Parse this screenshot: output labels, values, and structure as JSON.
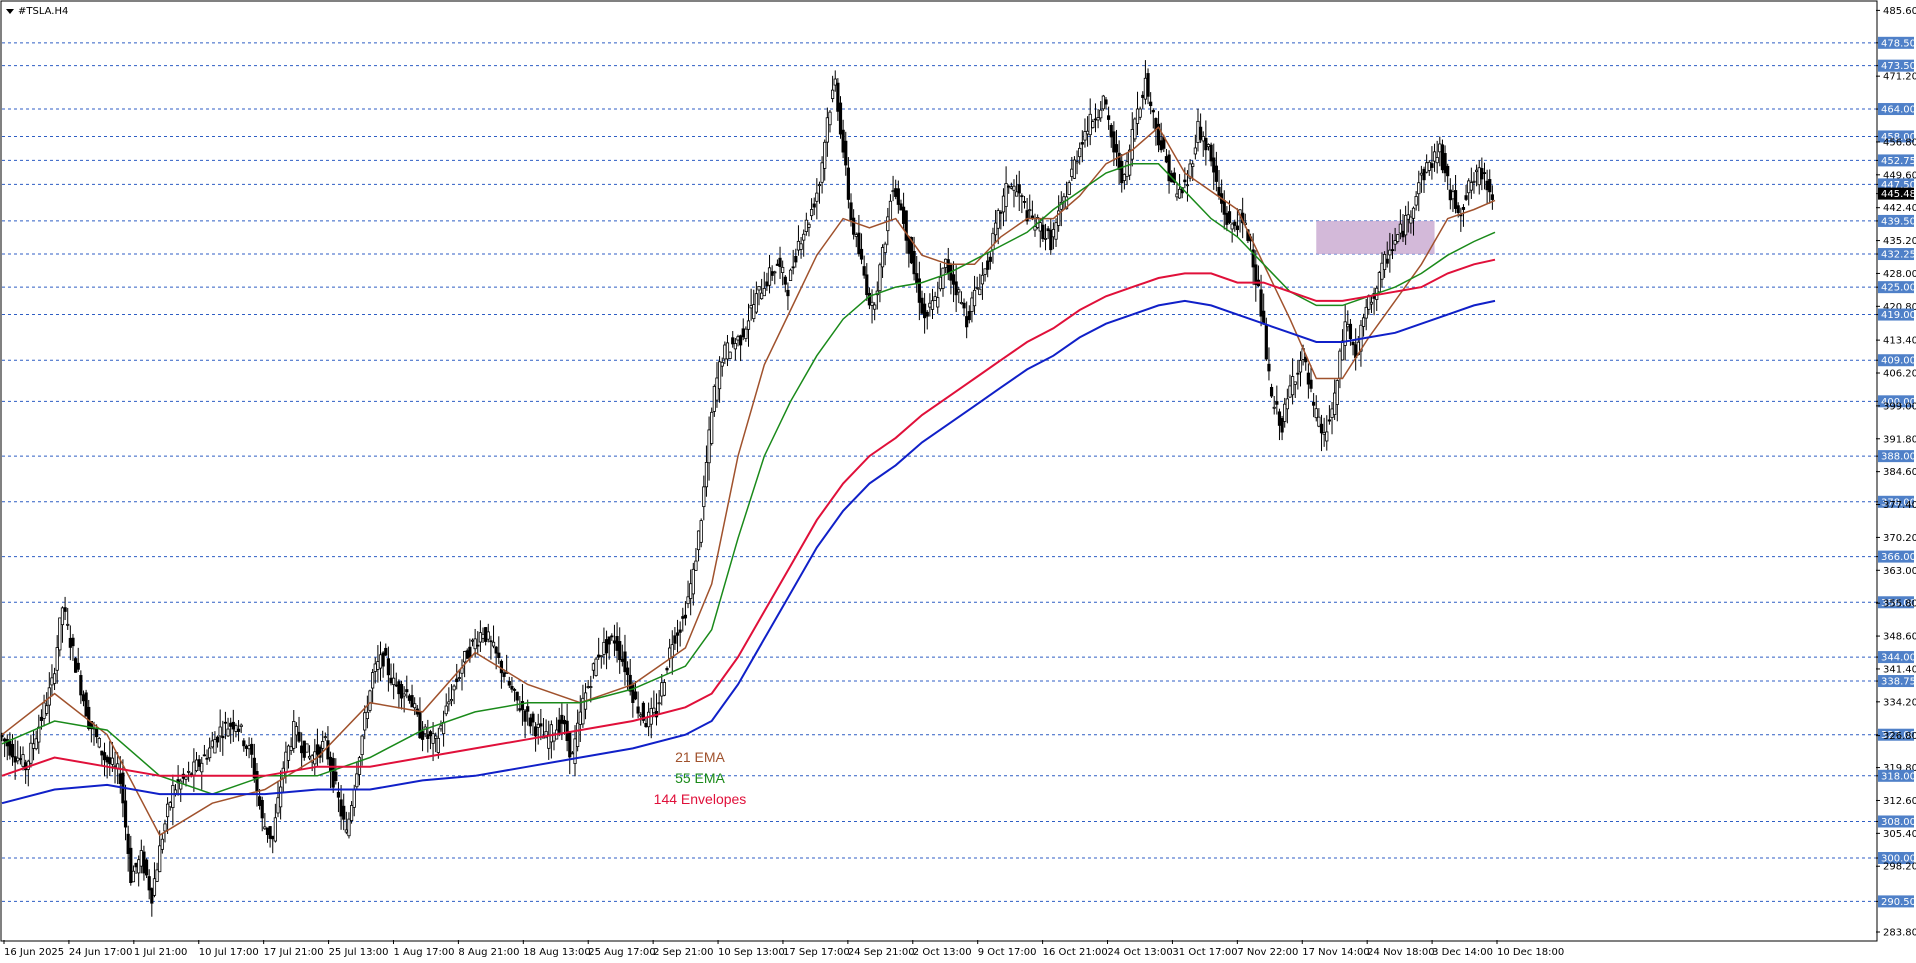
{
  "symbol": "#TSLA.H4",
  "colors": {
    "level_line": "#2f5ec4",
    "level_label_bg": "#4f80c8",
    "ema21": "#a0522d",
    "ema55": "#1a8a1a",
    "env144_upper": "#e0103a",
    "env144_lower": "#1020c8",
    "candle": "#000000",
    "zone": "#c8a8d0",
    "price_label_bg": "#000000"
  },
  "legend": [
    {
      "text": "21 EMA",
      "color": "#a0522d"
    },
    {
      "text": "55 EMA",
      "color": "#1a8a1a"
    },
    {
      "text": "144 Envelopes",
      "color": "#e0103a"
    }
  ],
  "y_ticks": [
    "485.60",
    "478.50",
    "473.50",
    "471.20",
    "464.00",
    "458.00",
    "456.80",
    "452.75",
    "449.60",
    "447.50",
    "445.48",
    "442.40",
    "439.50",
    "435.20",
    "432.25",
    "428.00",
    "425.00",
    "420.80",
    "419.00",
    "413.40",
    "409.00",
    "406.20",
    "400.00",
    "399.00",
    "391.80",
    "388.00",
    "384.60",
    "378.00",
    "377.40",
    "370.20",
    "366.00",
    "363.00",
    "356.00",
    "355.80",
    "348.60",
    "344.00",
    "341.40",
    "338.75",
    "334.20",
    "327.00",
    "326.80",
    "319.80",
    "318.00",
    "312.60",
    "308.00",
    "305.40",
    "300.00",
    "298.20",
    "290.50",
    "283.80"
  ],
  "x_ticks": [
    "16 Jun 2025",
    "24 Jun 17:00",
    "1 Jul 21:00",
    "10 Jul 17:00",
    "17 Jul 21:00",
    "25 Jul 13:00",
    "1 Aug 17:00",
    "8 Aug 21:00",
    "18 Aug 13:00",
    "25 Aug 17:00",
    "2 Sep 21:00",
    "10 Sep 13:00",
    "17 Sep 17:00",
    "24 Sep 21:00",
    "2 Oct 13:00",
    "9 Oct 17:00",
    "16 Oct 21:00",
    "24 Oct 13:00",
    "31 Oct 17:00",
    "7 Nov 22:00",
    "17 Nov 14:00",
    "24 Nov 18:00",
    "3 Dec 14:00",
    "10 Dec 18:00"
  ],
  "chart_data": {
    "type": "candlestick",
    "title": "#TSLA.H4",
    "ylim": [
      283.8,
      487.0
    ],
    "current_price": 445.48,
    "levels": [
      478.5,
      473.5,
      464.0,
      458.0,
      452.75,
      447.5,
      439.5,
      432.25,
      425.0,
      419.0,
      409.0,
      400.0,
      388.0,
      378.0,
      366.0,
      356.0,
      344.0,
      338.75,
      327.0,
      318.0,
      308.0,
      300.0,
      290.5
    ],
    "zone": {
      "from_x": "24 Nov 18:00",
      "to_x": "10 Dec 18:00",
      "low": 432.25,
      "high": 439.5
    },
    "price_path": [
      [
        0,
        327
      ],
      [
        10,
        320
      ],
      [
        20,
        338
      ],
      [
        24,
        355
      ],
      [
        28,
        345
      ],
      [
        34,
        330
      ],
      [
        40,
        322
      ],
      [
        46,
        318
      ],
      [
        50,
        296
      ],
      [
        54,
        300
      ],
      [
        58,
        292
      ],
      [
        62,
        305
      ],
      [
        66,
        315
      ],
      [
        72,
        318
      ],
      [
        78,
        322
      ],
      [
        84,
        328
      ],
      [
        90,
        330
      ],
      [
        96,
        322
      ],
      [
        100,
        308
      ],
      [
        104,
        304
      ],
      [
        108,
        320
      ],
      [
        112,
        328
      ],
      [
        118,
        322
      ],
      [
        124,
        325
      ],
      [
        128,
        315
      ],
      [
        132,
        305
      ],
      [
        136,
        320
      ],
      [
        142,
        340
      ],
      [
        146,
        344
      ],
      [
        150,
        338
      ],
      [
        156,
        336
      ],
      [
        160,
        328
      ],
      [
        166,
        325
      ],
      [
        172,
        336
      ],
      [
        178,
        345
      ],
      [
        184,
        350
      ],
      [
        190,
        343
      ],
      [
        196,
        335
      ],
      [
        202,
        330
      ],
      [
        208,
        326
      ],
      [
        214,
        330
      ],
      [
        218,
        322
      ],
      [
        222,
        334
      ],
      [
        228,
        345
      ],
      [
        234,
        348
      ],
      [
        238,
        342
      ],
      [
        242,
        334
      ],
      [
        246,
        330
      ],
      [
        250,
        332
      ],
      [
        256,
        348
      ],
      [
        260,
        352
      ],
      [
        264,
        362
      ],
      [
        267,
        375
      ],
      [
        270,
        392
      ],
      [
        272,
        402
      ],
      [
        275,
        410
      ],
      [
        278,
        412
      ],
      [
        282,
        414
      ],
      [
        286,
        420
      ],
      [
        290,
        425
      ],
      [
        296,
        430
      ],
      [
        300,
        425
      ],
      [
        304,
        435
      ],
      [
        308,
        440
      ],
      [
        312,
        448
      ],
      [
        315,
        462
      ],
      [
        318,
        470
      ],
      [
        321,
        455
      ],
      [
        324,
        440
      ],
      [
        328,
        430
      ],
      [
        332,
        420
      ],
      [
        336,
        432
      ],
      [
        340,
        448
      ],
      [
        344,
        440
      ],
      [
        348,
        428
      ],
      [
        352,
        418
      ],
      [
        356,
        422
      ],
      [
        360,
        430
      ],
      [
        364,
        425
      ],
      [
        368,
        418
      ],
      [
        372,
        425
      ],
      [
        376,
        430
      ],
      [
        380,
        440
      ],
      [
        384,
        448
      ],
      [
        388,
        445
      ],
      [
        392,
        440
      ],
      [
        396,
        438
      ],
      [
        400,
        435
      ],
      [
        404,
        442
      ],
      [
        408,
        450
      ],
      [
        412,
        458
      ],
      [
        416,
        462
      ],
      [
        420,
        466
      ],
      [
        424,
        455
      ],
      [
        428,
        448
      ],
      [
        432,
        462
      ],
      [
        436,
        470
      ],
      [
        440,
        460
      ],
      [
        444,
        452
      ],
      [
        448,
        445
      ],
      [
        452,
        448
      ],
      [
        456,
        460
      ],
      [
        460,
        455
      ],
      [
        464,
        445
      ],
      [
        468,
        438
      ],
      [
        472,
        440
      ],
      [
        476,
        435
      ],
      [
        480,
        420
      ],
      [
        484,
        400
      ],
      [
        488,
        395
      ],
      [
        492,
        405
      ],
      [
        496,
        410
      ],
      [
        500,
        398
      ],
      [
        504,
        392
      ],
      [
        508,
        400
      ],
      [
        512,
        418
      ],
      [
        516,
        410
      ],
      [
        520,
        420
      ],
      [
        524,
        425
      ],
      [
        528,
        432
      ],
      [
        532,
        436
      ],
      [
        536,
        440
      ],
      [
        540,
        448
      ],
      [
        544,
        452
      ],
      [
        548,
        455
      ],
      [
        552,
        445
      ],
      [
        556,
        442
      ],
      [
        560,
        448
      ],
      [
        564,
        450
      ],
      [
        568,
        446
      ]
    ],
    "series": [
      {
        "name": "21 EMA",
        "points": [
          [
            0,
            327
          ],
          [
            20,
            336
          ],
          [
            40,
            327
          ],
          [
            60,
            305
          ],
          [
            80,
            312
          ],
          [
            100,
            315
          ],
          [
            120,
            322
          ],
          [
            140,
            334
          ],
          [
            160,
            332
          ],
          [
            180,
            345
          ],
          [
            200,
            338
          ],
          [
            220,
            334
          ],
          [
            240,
            338
          ],
          [
            260,
            346
          ],
          [
            270,
            360
          ],
          [
            280,
            388
          ],
          [
            290,
            408
          ],
          [
            300,
            420
          ],
          [
            310,
            432
          ],
          [
            320,
            440
          ],
          [
            330,
            438
          ],
          [
            340,
            440
          ],
          [
            350,
            432
          ],
          [
            360,
            430
          ],
          [
            370,
            430
          ],
          [
            380,
            436
          ],
          [
            390,
            440
          ],
          [
            400,
            440
          ],
          [
            410,
            445
          ],
          [
            420,
            452
          ],
          [
            430,
            455
          ],
          [
            440,
            460
          ],
          [
            450,
            450
          ],
          [
            460,
            446
          ],
          [
            470,
            442
          ],
          [
            480,
            430
          ],
          [
            490,
            418
          ],
          [
            500,
            405
          ],
          [
            510,
            405
          ],
          [
            520,
            414
          ],
          [
            530,
            422
          ],
          [
            540,
            430
          ],
          [
            550,
            440
          ],
          [
            560,
            442
          ],
          [
            568,
            444
          ]
        ]
      },
      {
        "name": "55 EMA",
        "points": [
          [
            0,
            325
          ],
          [
            20,
            330
          ],
          [
            40,
            328
          ],
          [
            60,
            318
          ],
          [
            80,
            314
          ],
          [
            100,
            318
          ],
          [
            120,
            318
          ],
          [
            140,
            322
          ],
          [
            160,
            328
          ],
          [
            180,
            332
          ],
          [
            200,
            334
          ],
          [
            220,
            334
          ],
          [
            240,
            337
          ],
          [
            260,
            342
          ],
          [
            270,
            350
          ],
          [
            280,
            370
          ],
          [
            290,
            388
          ],
          [
            300,
            400
          ],
          [
            310,
            410
          ],
          [
            320,
            418
          ],
          [
            330,
            423
          ],
          [
            340,
            425
          ],
          [
            350,
            426
          ],
          [
            360,
            428
          ],
          [
            370,
            431
          ],
          [
            380,
            434
          ],
          [
            390,
            437
          ],
          [
            400,
            442
          ],
          [
            410,
            446
          ],
          [
            420,
            450
          ],
          [
            430,
            452
          ],
          [
            440,
            452
          ],
          [
            450,
            446
          ],
          [
            460,
            440
          ],
          [
            470,
            436
          ],
          [
            480,
            430
          ],
          [
            490,
            424
          ],
          [
            500,
            421
          ],
          [
            510,
            421
          ],
          [
            520,
            423
          ],
          [
            530,
            425
          ],
          [
            540,
            428
          ],
          [
            550,
            432
          ],
          [
            560,
            435
          ],
          [
            568,
            437
          ]
        ]
      },
      {
        "name": "144 Envelopes",
        "points": [
          [
            0,
            318
          ],
          [
            20,
            322
          ],
          [
            40,
            320
          ],
          [
            60,
            318
          ],
          [
            80,
            318
          ],
          [
            100,
            318
          ],
          [
            120,
            320
          ],
          [
            140,
            320
          ],
          [
            160,
            322
          ],
          [
            180,
            324
          ],
          [
            200,
            326
          ],
          [
            220,
            328
          ],
          [
            240,
            330
          ],
          [
            260,
            333
          ],
          [
            270,
            336
          ],
          [
            280,
            344
          ],
          [
            290,
            354
          ],
          [
            300,
            364
          ],
          [
            310,
            374
          ],
          [
            320,
            382
          ],
          [
            330,
            388
          ],
          [
            340,
            392
          ],
          [
            350,
            397
          ],
          [
            360,
            401
          ],
          [
            370,
            405
          ],
          [
            380,
            409
          ],
          [
            390,
            413
          ],
          [
            400,
            416
          ],
          [
            410,
            420
          ],
          [
            420,
            423
          ],
          [
            430,
            425
          ],
          [
            440,
            427
          ],
          [
            450,
            428
          ],
          [
            460,
            428
          ],
          [
            470,
            426
          ],
          [
            480,
            426
          ],
          [
            490,
            424
          ],
          [
            500,
            422
          ],
          [
            510,
            422
          ],
          [
            520,
            423
          ],
          [
            530,
            424
          ],
          [
            540,
            425
          ],
          [
            550,
            428
          ],
          [
            560,
            430
          ],
          [
            568,
            431
          ]
        ]
      },
      {
        "name": "",
        "points": [
          [
            0,
            312
          ],
          [
            20,
            315
          ],
          [
            40,
            316
          ],
          [
            60,
            314
          ],
          [
            80,
            314
          ],
          [
            100,
            314
          ],
          [
            120,
            315
          ],
          [
            140,
            315
          ],
          [
            160,
            317
          ],
          [
            180,
            318
          ],
          [
            200,
            320
          ],
          [
            220,
            322
          ],
          [
            240,
            324
          ],
          [
            260,
            327
          ],
          [
            270,
            330
          ],
          [
            280,
            338
          ],
          [
            290,
            348
          ],
          [
            300,
            358
          ],
          [
            310,
            368
          ],
          [
            320,
            376
          ],
          [
            330,
            382
          ],
          [
            340,
            386
          ],
          [
            350,
            391
          ],
          [
            360,
            395
          ],
          [
            370,
            399
          ],
          [
            380,
            403
          ],
          [
            390,
            407
          ],
          [
            400,
            410
          ],
          [
            410,
            414
          ],
          [
            420,
            417
          ],
          [
            430,
            419
          ],
          [
            440,
            421
          ],
          [
            450,
            422
          ],
          [
            460,
            421
          ],
          [
            470,
            419
          ],
          [
            480,
            417
          ],
          [
            490,
            415
          ],
          [
            500,
            413
          ],
          [
            510,
            413
          ],
          [
            520,
            414
          ],
          [
            530,
            415
          ],
          [
            540,
            417
          ],
          [
            550,
            419
          ],
          [
            560,
            421
          ],
          [
            568,
            422
          ]
        ]
      }
    ]
  }
}
